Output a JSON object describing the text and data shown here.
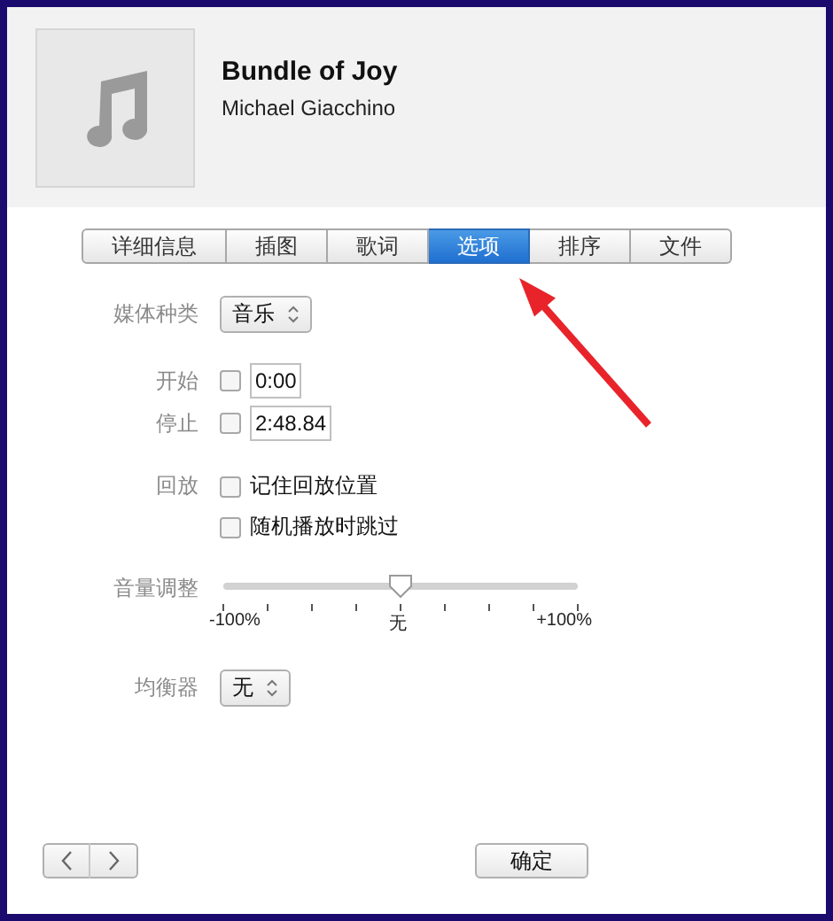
{
  "header": {
    "title": "Bundle of Joy",
    "artist": "Michael Giacchino"
  },
  "tabs": [
    {
      "label": "详细信息",
      "selected": false
    },
    {
      "label": "插图",
      "selected": false
    },
    {
      "label": "歌词",
      "selected": false
    },
    {
      "label": "选项",
      "selected": true
    },
    {
      "label": "排序",
      "selected": false
    },
    {
      "label": "文件",
      "selected": false
    }
  ],
  "media_kind": {
    "label": "媒体种类",
    "value": "音乐"
  },
  "start": {
    "label": "开始",
    "checked": false,
    "value": "0:00"
  },
  "stop": {
    "label": "停止",
    "checked": false,
    "value": "2:48.84"
  },
  "playback": {
    "label": "回放",
    "options": [
      {
        "label": "记住回放位置",
        "checked": false
      },
      {
        "label": "随机播放时跳过",
        "checked": false
      }
    ]
  },
  "volume": {
    "label": "音量调整",
    "level": 0.5,
    "min_label": "-100%",
    "mid_label": "无",
    "max_label": "+100%"
  },
  "equalizer": {
    "label": "均衡器",
    "value": "无"
  },
  "buttons": [
    {
      "label": "确定"
    }
  ]
}
